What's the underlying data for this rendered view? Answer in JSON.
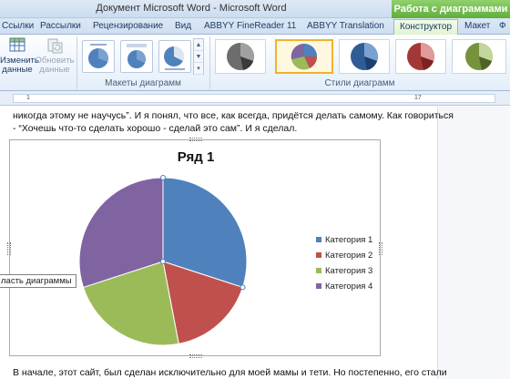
{
  "window": {
    "title": "Документ Microsoft Word  -  Microsoft Word",
    "context_header": "Работа с диаграммами"
  },
  "tabs": [
    {
      "label": "Ссылки"
    },
    {
      "label": "Рассылки"
    },
    {
      "label": "Рецензирование"
    },
    {
      "label": "Вид"
    },
    {
      "label": "ABBYY FineReader 11"
    },
    {
      "label": "ABBYY Translation"
    },
    {
      "label": "Конструктор"
    },
    {
      "label": "Макет"
    },
    {
      "label": "Ф"
    }
  ],
  "ribbon": {
    "change_data_label_1": "Изменить",
    "change_data_label_2": "данные",
    "refresh_data_label_1": "Обновить",
    "refresh_data_label_2": "данные",
    "layouts_group": "Макеты диаграмм",
    "styles_group": "Стили диаграмм"
  },
  "ruler": {
    "left_num": "1",
    "right_num": "17"
  },
  "document": {
    "line1": "никогда этому не научусь”. И я понял, что все, как всегда, придётся делать самому. Как говориться",
    "line2": "- “Хочешь что-то сделать хорошо - сделай это сам”. И я сделал.",
    "line3": "В начале, этот сайт, был сделан исключительно для моей мамы и тети. Но постепенно, его стали"
  },
  "tooltip": "ласть диаграммы",
  "colors": {
    "series1": "#4f81bd",
    "series2": "#c0504d",
    "series3": "#9bbb59",
    "series4": "#8064a2"
  },
  "chart_data": {
    "type": "pie",
    "title": "Ряд 1",
    "categories": [
      "Категория 1",
      "Категория 2",
      "Категория 3",
      "Категория 4"
    ],
    "values": [
      30,
      17,
      23,
      30
    ],
    "legend_position": "right"
  }
}
